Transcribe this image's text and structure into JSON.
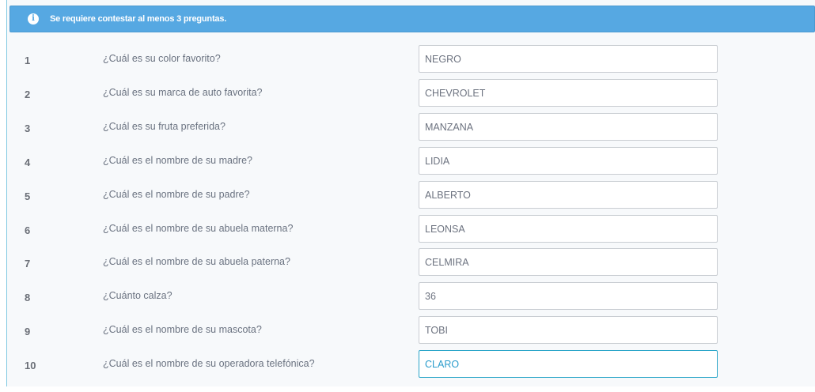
{
  "alert": {
    "icon": "info-icon",
    "message": "Se requiere contestar al menos 3 preguntas."
  },
  "questions": [
    {
      "num": "1",
      "text": "¿Cuál es su color favorito?",
      "answer": "NEGRO"
    },
    {
      "num": "2",
      "text": "¿Cuál es su marca de auto favorita?",
      "answer": "CHEVROLET"
    },
    {
      "num": "3",
      "text": "¿Cuál es su fruta preferida?",
      "answer": "MANZANA"
    },
    {
      "num": "4",
      "text": "¿Cuál es el nombre de su madre?",
      "answer": "LIDIA"
    },
    {
      "num": "5",
      "text": "¿Cuál es el nombre de su padre?",
      "answer": "ALBERTO"
    },
    {
      "num": "6",
      "text": "¿Cuál es el nombre de su abuela materna?",
      "answer": "LEONSA"
    },
    {
      "num": "7",
      "text": "¿Cuál es el nombre de su abuela paterna?",
      "answer": "CELMIRA"
    },
    {
      "num": "8",
      "text": "¿Cuánto calza?",
      "answer": "36"
    },
    {
      "num": "9",
      "text": "¿Cuál es el nombre de su mascota?",
      "answer": "TOBI"
    },
    {
      "num": "10",
      "text": "¿Cuál es el nombre de su operadora telefónica?",
      "answer": "CLARO"
    }
  ],
  "colors": {
    "alert_bg": "#56a8e2",
    "focus_border": "#2aa5c8",
    "focus_text": "#2a9ccc"
  }
}
